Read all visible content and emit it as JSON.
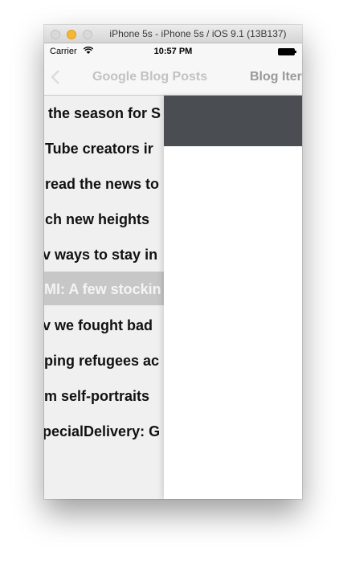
{
  "window": {
    "title": "iPhone 5s - iPhone 5s / iOS 9.1 (13B137)"
  },
  "status_bar": {
    "carrier": "Carrier",
    "time": "10:57 PM"
  },
  "nav": {
    "title": "Google Blog Posts",
    "next_title": "Blog Iter"
  },
  "posts": [
    {
      "label": "the season for S"
    },
    {
      "label": "Tube creators ir"
    },
    {
      "label": "read the news to"
    },
    {
      "label": "ch new heights"
    },
    {
      "label": "v ways to stay in"
    },
    {
      "label": "MI: A few stockin",
      "selected": true
    },
    {
      "label": "v we fought bad"
    },
    {
      "label": "ping refugees ac"
    },
    {
      "label": "m self-portraits"
    },
    {
      "label": "pecialDelivery: G"
    }
  ],
  "colors": {
    "detail_header": "#4a4d51",
    "selected_row": "#c7c7c7"
  }
}
